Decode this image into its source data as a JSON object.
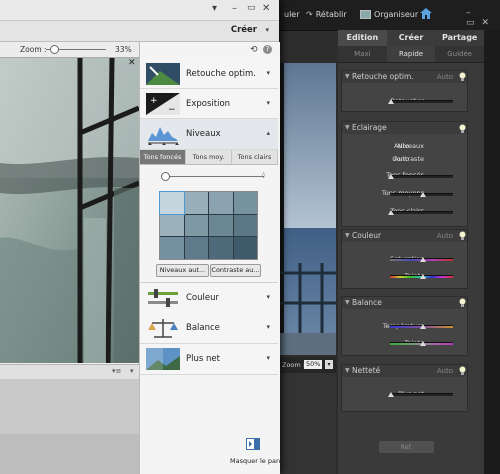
{
  "bg": {
    "top": {
      "item1": "uler",
      "item2": "Rétablir",
      "item3": "Organiseur"
    },
    "tabs": [
      "Edition",
      "Créer",
      "Partage"
    ],
    "subtabs": [
      "Maxi",
      "Rapide",
      "Guidée"
    ],
    "sections": {
      "retouche": {
        "title": "Retouche optim.",
        "auto": "Auto",
        "row": "Retoucher"
      },
      "eclairage": {
        "title": "Eclairage",
        "niveaux_label": "Niveaux",
        "niveaux_val": "Auto",
        "contraste_label": "Contraste",
        "contraste_val": "Auto",
        "sliders": [
          "Tons foncés",
          "Tons moyens",
          "Tons clairs"
        ]
      },
      "couleur": {
        "title": "Couleur",
        "auto": "Auto",
        "sliders": [
          "Saturation",
          "Teinte"
        ]
      },
      "balance": {
        "title": "Balance",
        "sliders": [
          "Température",
          "Teinte"
        ]
      },
      "nettete": {
        "title": "Netteté",
        "auto": "Auto",
        "row": "Plus net"
      }
    },
    "footer_btn": "Réf.",
    "zoom_label": "Zoom :",
    "zoom_val": "50%"
  },
  "win": {
    "creer": "Créer",
    "zoom_label": "Zoom :",
    "zoom_val": "33%",
    "tools": {
      "retouche": "Retouche optim.",
      "exposition": "Exposition",
      "niveaux": "Niveaux",
      "couleur": "Couleur",
      "balance": "Balance",
      "plus_net": "Plus net"
    },
    "niveaux_tabs": [
      "Tons foncés",
      "Tons moy.",
      "Tons clairs"
    ],
    "btn_niveaux_auto": "Niveaux aut...",
    "btn_contraste_auto": "Contraste au...",
    "masquer": "Masquer le pan..."
  },
  "icons": [
    "home-icon",
    "help-icon",
    "close-icon",
    "chevron-down-icon",
    "undo-icon",
    "redo-icon",
    "bulb-icon"
  ]
}
